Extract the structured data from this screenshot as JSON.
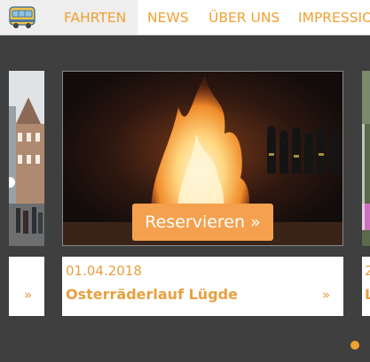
{
  "nav": {
    "items": [
      {
        "label": "FAHRTEN"
      },
      {
        "label": "NEWS"
      },
      {
        "label": "ÜBER UNS"
      },
      {
        "label": "IMPRESSIO"
      }
    ]
  },
  "cards": [
    {
      "date": "",
      "title": "",
      "more": "»"
    },
    {
      "date": "01.04.2018",
      "title": "Osterräderlauf Lügde",
      "more": "»"
    },
    {
      "date": "2",
      "title": "L",
      "more": ""
    }
  ],
  "reserve": {
    "label": "Reservieren »"
  },
  "colors": {
    "accent": "#f0a030",
    "background": "#3f3f3f",
    "button": "#f5a04e"
  }
}
